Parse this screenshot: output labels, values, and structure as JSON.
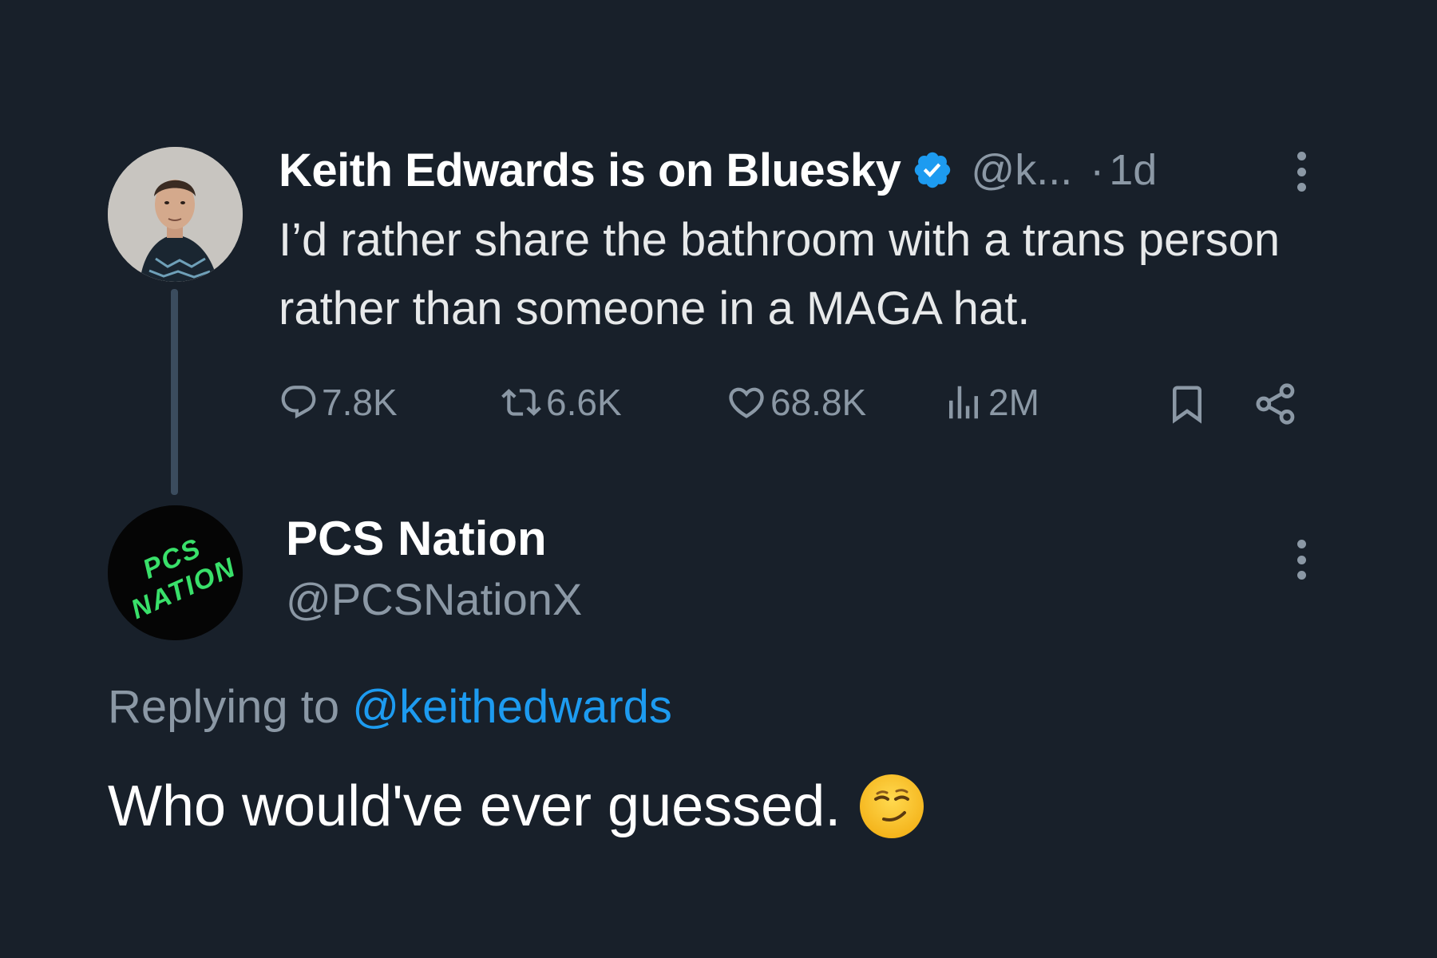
{
  "colors": {
    "background": "#18202a",
    "primary_text": "#e7e9ea",
    "secondary_text": "#8b98a5",
    "accent": "#1d9bf0",
    "thread_line": "#3b4c5e"
  },
  "original_tweet": {
    "author_name": "Keith Edwards is on Bluesky",
    "verified_icon": "verified-badge-icon",
    "handle": "@k...",
    "separator": "·",
    "time": "1d",
    "text": "I’d rather share the bathroom with a trans person rather than someone in a MAGA hat.",
    "stats": {
      "replies": "7.8K",
      "reposts": "6.6K",
      "likes": "68.8K",
      "views": "2M"
    },
    "icons": [
      "reply-icon",
      "repost-icon",
      "like-icon",
      "views-icon",
      "bookmark-icon",
      "share-icon",
      "more-icon"
    ]
  },
  "reply_tweet": {
    "author_name": "PCS Nation",
    "handle": "@PCSNationX",
    "avatar_text": "PCS NATION",
    "replying_prefix": "Replying to",
    "replying_to": "@keithedwards",
    "text": "Who would've ever guessed.",
    "emoji": "smirking-face-emoji"
  }
}
